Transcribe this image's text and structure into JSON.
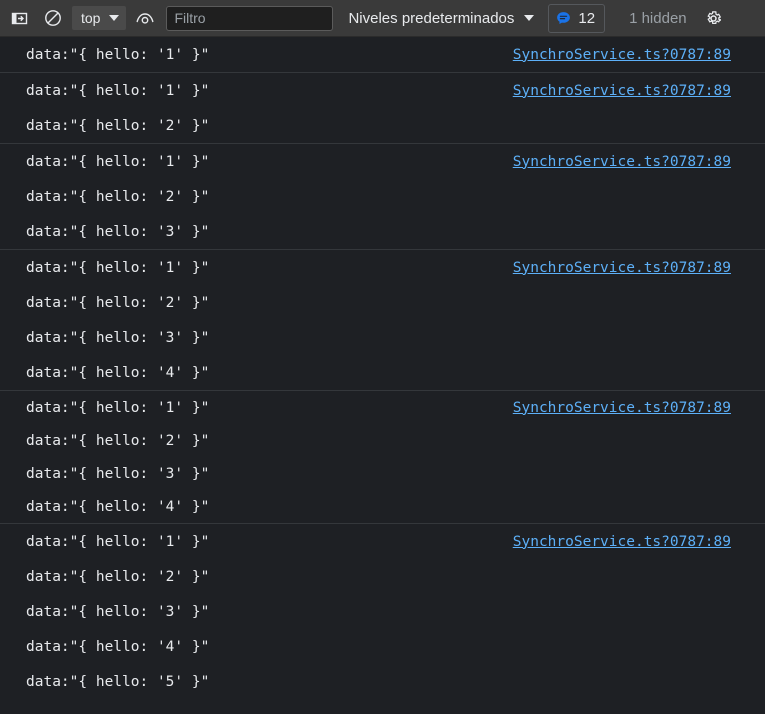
{
  "toolbar": {
    "drawer_toggle_icon": "open-drawer-icon",
    "clear_console_icon": "clear-console-icon",
    "context_selector": {
      "value": "top",
      "caret_icon": "chevron-down-icon"
    },
    "live_expression_icon": "eye-icon",
    "filter": {
      "placeholder": "Filtro",
      "value": ""
    },
    "levels": {
      "label": "Niveles predeterminados",
      "caret_icon": "chevron-down-icon"
    },
    "message_badge": {
      "icon": "message-bubble-icon",
      "count": "12",
      "accent_color": "#1a73e8"
    },
    "hidden_note": "1 hidden",
    "settings_icon": "gear-icon"
  },
  "colors": {
    "toolbar_bg": "#3a3a3a",
    "console_bg": "#1e2024",
    "separator": "#34373b",
    "text": "#e8eaed",
    "link": "#5db0f8",
    "muted": "#9aa0a6"
  },
  "console": {
    "source_link": "SynchroService.ts?0787:89",
    "groups": [
      {
        "rows": [
          {
            "text": "data:\"{ hello: '1' }\"",
            "source": "SynchroService.ts?0787:89"
          }
        ]
      },
      {
        "rows": [
          {
            "text": "data:\"{ hello: '1' }\"",
            "source": "SynchroService.ts?0787:89"
          },
          {
            "text": "data:\"{ hello: '2' }\"",
            "source": ""
          }
        ]
      },
      {
        "rows": [
          {
            "text": "data:\"{ hello: '1' }\"",
            "source": "SynchroService.ts?0787:89"
          },
          {
            "text": "data:\"{ hello: '2' }\"",
            "source": ""
          },
          {
            "text": "data:\"{ hello: '3' }\"",
            "source": ""
          }
        ]
      },
      {
        "rows": [
          {
            "text": "data:\"{ hello: '1' }\"",
            "source": "SynchroService.ts?0787:89"
          },
          {
            "text": "data:\"{ hello: '2' }\"",
            "source": ""
          },
          {
            "text": "data:\"{ hello: '3' }\"",
            "source": ""
          },
          {
            "text": "data:\"{ hello: '4' }\"",
            "source": ""
          }
        ]
      },
      {
        "rows": [
          {
            "text": "data:\"{ hello: '1' }\"",
            "source": "SynchroService.ts?0787:89"
          },
          {
            "text": "data:\"{ hello: '2' }\"",
            "source": ""
          },
          {
            "text": "data:\"{ hello: '3' }\"",
            "source": ""
          },
          {
            "text": "data:\"{ hello: '4' }\"",
            "source": ""
          }
        ]
      },
      {
        "rows": [
          {
            "text": "data:\"{ hello: '1' }\"",
            "source": "SynchroService.ts?0787:89"
          },
          {
            "text": "data:\"{ hello: '2' }\"",
            "source": ""
          },
          {
            "text": "data:\"{ hello: '3' }\"",
            "source": ""
          },
          {
            "text": "data:\"{ hello: '4' }\"",
            "source": ""
          },
          {
            "text": "data:\"{ hello: '5' }\"",
            "source": ""
          }
        ]
      }
    ]
  }
}
